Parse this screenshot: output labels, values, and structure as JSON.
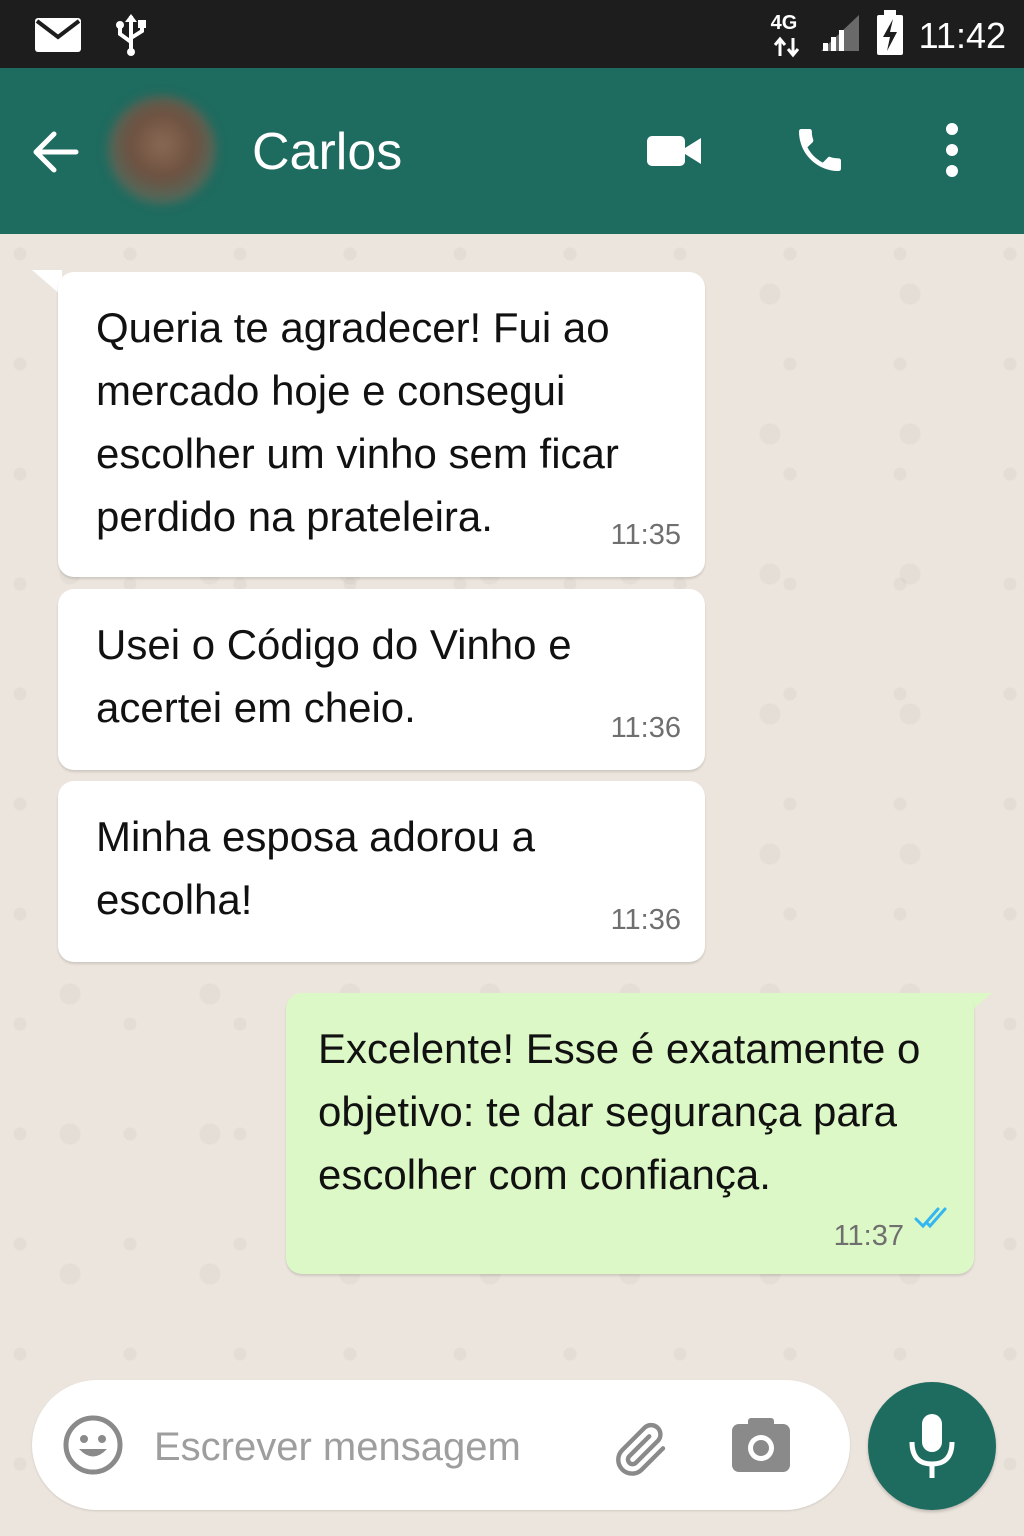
{
  "status_bar": {
    "network": "4G",
    "time": "11:42",
    "icons": [
      "mail-icon",
      "usb-icon",
      "network-4g-icon",
      "signal-icon",
      "battery-charging-icon"
    ]
  },
  "header": {
    "contact_name": "Carlos",
    "icons": [
      "back-arrow-icon",
      "video-call-icon",
      "phone-icon",
      "more-options-icon"
    ]
  },
  "messages": [
    {
      "direction": "incoming",
      "text": "Queria te agradecer! Fui ao mercado hoje e consegui escolher um vinho sem ficar perdido na prateleira.",
      "time": "11:35"
    },
    {
      "direction": "incoming",
      "text": "Usei o Código do Vinho e acertei em cheio.",
      "time": "11:36"
    },
    {
      "direction": "incoming",
      "text": "Minha esposa adorou a escolha!",
      "time": "11:36"
    },
    {
      "direction": "outgoing",
      "text": "Excelente! Esse é exatamente o objetivo: te dar segurança para escolher com confiança.",
      "time": "11:37",
      "status": "read"
    }
  ],
  "composer": {
    "placeholder": "Escrever mensagem",
    "value": "",
    "icons": [
      "emoji-icon",
      "attach-icon",
      "camera-icon",
      "mic-icon"
    ]
  },
  "colors": {
    "header": "#1e6b5f",
    "status_bar": "#1d1d1d",
    "chat_background": "#ece5dd",
    "incoming_bubble": "#ffffff",
    "outgoing_bubble": "#dcf8c6",
    "read_ticks": "#34b7f1"
  }
}
